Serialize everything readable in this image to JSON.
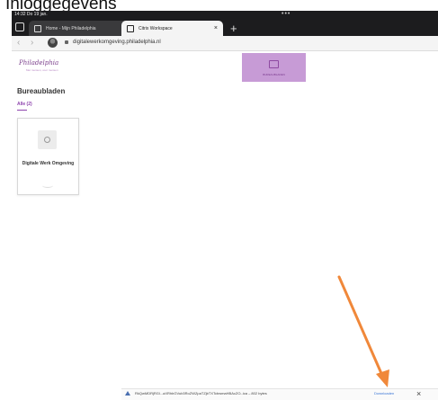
{
  "heading": "Inloggegevens",
  "statusbar": {
    "clock": "14:32  Do 19 jan."
  },
  "tabs": [
    {
      "label": "Home - Mijn Philadelphia",
      "close": "×"
    },
    {
      "label": "Citrix Workspace",
      "close": "×"
    }
  ],
  "new_tab": "+",
  "address_bar": {
    "url": "digitalewerkomgeving.philadelphia.nl",
    "back": "‹",
    "forward": "›"
  },
  "brand": {
    "logo_text": "Philadelphia",
    "logo_subtitle": "Met mensen, voor mensen"
  },
  "desktops_tile": {
    "label": "BUREAUBLADEN"
  },
  "section": {
    "title": "Bureaubladen",
    "filter": "Alle (2)"
  },
  "card": {
    "label": "Digitale Werk Omgeving"
  },
  "download": {
    "filename": "RkQwMDRjRGl...aXRhbGVub3RoZWZpaTZjbTXTcbwmaHBAcZO-.ica – 802 bytes",
    "action": "Downloaden",
    "close": "×"
  },
  "colors": {
    "brand_purple": "#8e44ad",
    "tile_purple": "#c79bd6",
    "arrow_orange": "#f0883a"
  }
}
